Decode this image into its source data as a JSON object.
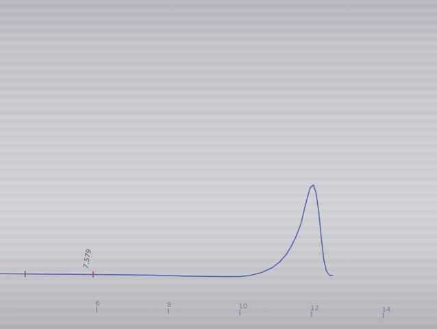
{
  "chart_data": {
    "type": "line",
    "title": "",
    "xlabel": "",
    "ylabel": "",
    "x_ticks": [
      6,
      8,
      10,
      12,
      14
    ],
    "x_tick_labels": [
      "6",
      "8",
      "10",
      "12",
      "14"
    ],
    "xlim": [
      3.3,
      15.5
    ],
    "ylim": [
      0,
      100
    ],
    "grid": false,
    "series": [
      {
        "color": "#5566a8",
        "x": [
          3.3,
          4.5,
          5.5,
          6.5,
          7.5,
          8.5,
          9.5,
          10.0,
          10.3,
          10.6,
          10.9,
          11.1,
          11.3,
          11.45,
          11.55,
          11.65,
          11.72,
          11.8,
          11.88,
          11.96,
          12.05,
          12.12,
          12.2,
          12.27,
          12.34,
          12.42,
          12.5,
          12.6
        ],
        "y": [
          0.5,
          0.4,
          0.3,
          0.2,
          0.0,
          -0.8,
          -1.2,
          -1.0,
          0.5,
          3.5,
          9,
          15,
          24,
          34,
          42,
          52,
          60,
          74,
          86,
          97,
          100,
          92,
          70,
          42,
          18,
          5,
          1,
          1
        ]
      }
    ],
    "baseline_marks": [
      {
        "x": 4.0,
        "color": "#c23a2a"
      },
      {
        "x": 5.9,
        "color": "#c23a2a"
      }
    ],
    "annotations": [
      {
        "text": "7.579",
        "x": 5.75,
        "y": 6
      }
    ]
  }
}
